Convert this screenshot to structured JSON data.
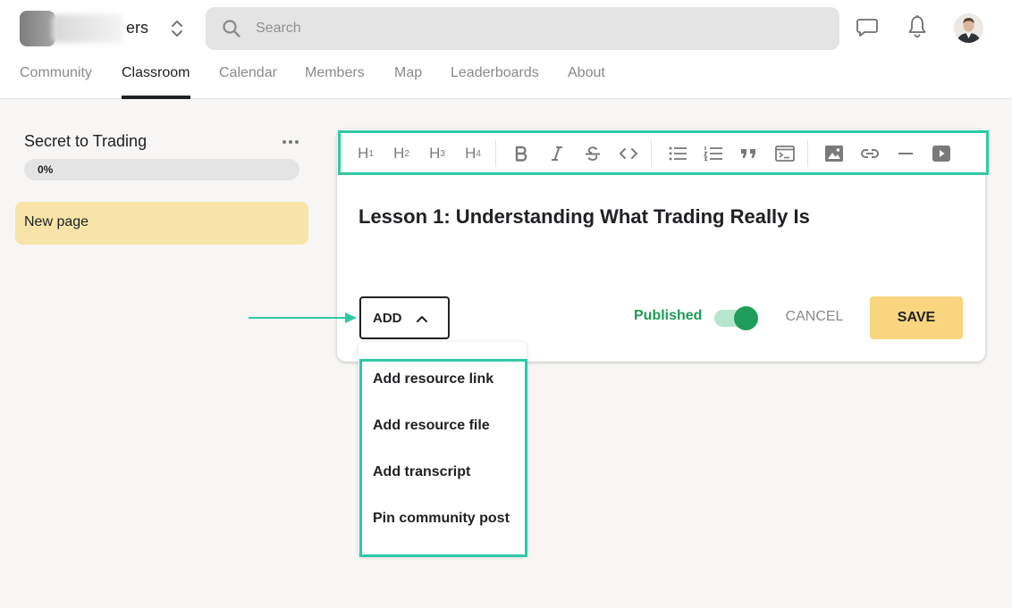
{
  "header": {
    "group_name": "ers",
    "search": {
      "placeholder": "Search",
      "value": ""
    },
    "tabs": [
      {
        "label": "Community"
      },
      {
        "label": "Classroom",
        "active": true
      },
      {
        "label": "Calendar"
      },
      {
        "label": "Members"
      },
      {
        "label": "Map"
      },
      {
        "label": "Leaderboards"
      },
      {
        "label": "About"
      }
    ],
    "icons": [
      "chat-icon",
      "bell-icon",
      "avatar"
    ]
  },
  "sidebar": {
    "course_title": "Secret to Trading",
    "progress": {
      "value": 0,
      "label": "0%"
    },
    "pages": [
      {
        "label": "New page",
        "selected": true
      }
    ]
  },
  "editor": {
    "toolbar": {
      "headings": [
        {
          "letter": "H",
          "level": "1"
        },
        {
          "letter": "H",
          "level": "2"
        },
        {
          "letter": "H",
          "level": "3"
        },
        {
          "letter": "H",
          "level": "4"
        }
      ],
      "format_icons": [
        "bold-icon",
        "italic-icon",
        "strikethrough-icon",
        "code-icon"
      ],
      "block_icons": [
        "bullet-list-icon",
        "numbered-list-icon",
        "quote-icon",
        "code-block-icon"
      ],
      "insert_icons": [
        "image-icon",
        "link-icon",
        "divider-icon",
        "video-icon"
      ]
    },
    "lesson_title": "Lesson 1: Understanding What Trading Really Is",
    "add_label": "ADD",
    "published_label": "Published",
    "published": true,
    "cancel_label": "CANCEL",
    "save_label": "SAVE"
  },
  "add_menu": {
    "items": [
      {
        "label": "Add resource link"
      },
      {
        "label": "Add resource file"
      },
      {
        "label": "Add transcript"
      },
      {
        "label": "Pin community post"
      }
    ]
  },
  "colors": {
    "highlight": "#2ec9a5",
    "published": "#1f9b57",
    "save": "#f8d57e",
    "selected_page": "#f8e4a9"
  }
}
